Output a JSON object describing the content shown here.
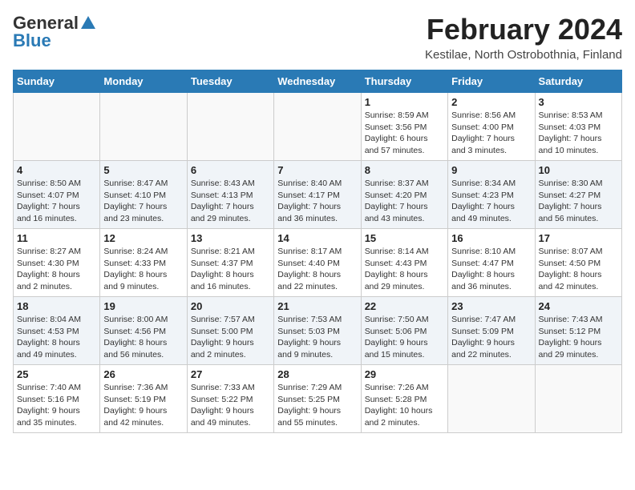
{
  "header": {
    "logo_general": "General",
    "logo_blue": "Blue",
    "month_year": "February 2024",
    "location": "Kestilae, North Ostrobothnia, Finland"
  },
  "days_of_week": [
    "Sunday",
    "Monday",
    "Tuesday",
    "Wednesday",
    "Thursday",
    "Friday",
    "Saturday"
  ],
  "weeks": [
    [
      {
        "day": "",
        "info": ""
      },
      {
        "day": "",
        "info": ""
      },
      {
        "day": "",
        "info": ""
      },
      {
        "day": "",
        "info": ""
      },
      {
        "day": "1",
        "info": "Sunrise: 8:59 AM\nSunset: 3:56 PM\nDaylight: 6 hours\nand 57 minutes."
      },
      {
        "day": "2",
        "info": "Sunrise: 8:56 AM\nSunset: 4:00 PM\nDaylight: 7 hours\nand 3 minutes."
      },
      {
        "day": "3",
        "info": "Sunrise: 8:53 AM\nSunset: 4:03 PM\nDaylight: 7 hours\nand 10 minutes."
      }
    ],
    [
      {
        "day": "4",
        "info": "Sunrise: 8:50 AM\nSunset: 4:07 PM\nDaylight: 7 hours\nand 16 minutes."
      },
      {
        "day": "5",
        "info": "Sunrise: 8:47 AM\nSunset: 4:10 PM\nDaylight: 7 hours\nand 23 minutes."
      },
      {
        "day": "6",
        "info": "Sunrise: 8:43 AM\nSunset: 4:13 PM\nDaylight: 7 hours\nand 29 minutes."
      },
      {
        "day": "7",
        "info": "Sunrise: 8:40 AM\nSunset: 4:17 PM\nDaylight: 7 hours\nand 36 minutes."
      },
      {
        "day": "8",
        "info": "Sunrise: 8:37 AM\nSunset: 4:20 PM\nDaylight: 7 hours\nand 43 minutes."
      },
      {
        "day": "9",
        "info": "Sunrise: 8:34 AM\nSunset: 4:23 PM\nDaylight: 7 hours\nand 49 minutes."
      },
      {
        "day": "10",
        "info": "Sunrise: 8:30 AM\nSunset: 4:27 PM\nDaylight: 7 hours\nand 56 minutes."
      }
    ],
    [
      {
        "day": "11",
        "info": "Sunrise: 8:27 AM\nSunset: 4:30 PM\nDaylight: 8 hours\nand 2 minutes."
      },
      {
        "day": "12",
        "info": "Sunrise: 8:24 AM\nSunset: 4:33 PM\nDaylight: 8 hours\nand 9 minutes."
      },
      {
        "day": "13",
        "info": "Sunrise: 8:21 AM\nSunset: 4:37 PM\nDaylight: 8 hours\nand 16 minutes."
      },
      {
        "day": "14",
        "info": "Sunrise: 8:17 AM\nSunset: 4:40 PM\nDaylight: 8 hours\nand 22 minutes."
      },
      {
        "day": "15",
        "info": "Sunrise: 8:14 AM\nSunset: 4:43 PM\nDaylight: 8 hours\nand 29 minutes."
      },
      {
        "day": "16",
        "info": "Sunrise: 8:10 AM\nSunset: 4:47 PM\nDaylight: 8 hours\nand 36 minutes."
      },
      {
        "day": "17",
        "info": "Sunrise: 8:07 AM\nSunset: 4:50 PM\nDaylight: 8 hours\nand 42 minutes."
      }
    ],
    [
      {
        "day": "18",
        "info": "Sunrise: 8:04 AM\nSunset: 4:53 PM\nDaylight: 8 hours\nand 49 minutes."
      },
      {
        "day": "19",
        "info": "Sunrise: 8:00 AM\nSunset: 4:56 PM\nDaylight: 8 hours\nand 56 minutes."
      },
      {
        "day": "20",
        "info": "Sunrise: 7:57 AM\nSunset: 5:00 PM\nDaylight: 9 hours\nand 2 minutes."
      },
      {
        "day": "21",
        "info": "Sunrise: 7:53 AM\nSunset: 5:03 PM\nDaylight: 9 hours\nand 9 minutes."
      },
      {
        "day": "22",
        "info": "Sunrise: 7:50 AM\nSunset: 5:06 PM\nDaylight: 9 hours\nand 15 minutes."
      },
      {
        "day": "23",
        "info": "Sunrise: 7:47 AM\nSunset: 5:09 PM\nDaylight: 9 hours\nand 22 minutes."
      },
      {
        "day": "24",
        "info": "Sunrise: 7:43 AM\nSunset: 5:12 PM\nDaylight: 9 hours\nand 29 minutes."
      }
    ],
    [
      {
        "day": "25",
        "info": "Sunrise: 7:40 AM\nSunset: 5:16 PM\nDaylight: 9 hours\nand 35 minutes."
      },
      {
        "day": "26",
        "info": "Sunrise: 7:36 AM\nSunset: 5:19 PM\nDaylight: 9 hours\nand 42 minutes."
      },
      {
        "day": "27",
        "info": "Sunrise: 7:33 AM\nSunset: 5:22 PM\nDaylight: 9 hours\nand 49 minutes."
      },
      {
        "day": "28",
        "info": "Sunrise: 7:29 AM\nSunset: 5:25 PM\nDaylight: 9 hours\nand 55 minutes."
      },
      {
        "day": "29",
        "info": "Sunrise: 7:26 AM\nSunset: 5:28 PM\nDaylight: 10 hours\nand 2 minutes."
      },
      {
        "day": "",
        "info": ""
      },
      {
        "day": "",
        "info": ""
      }
    ]
  ]
}
